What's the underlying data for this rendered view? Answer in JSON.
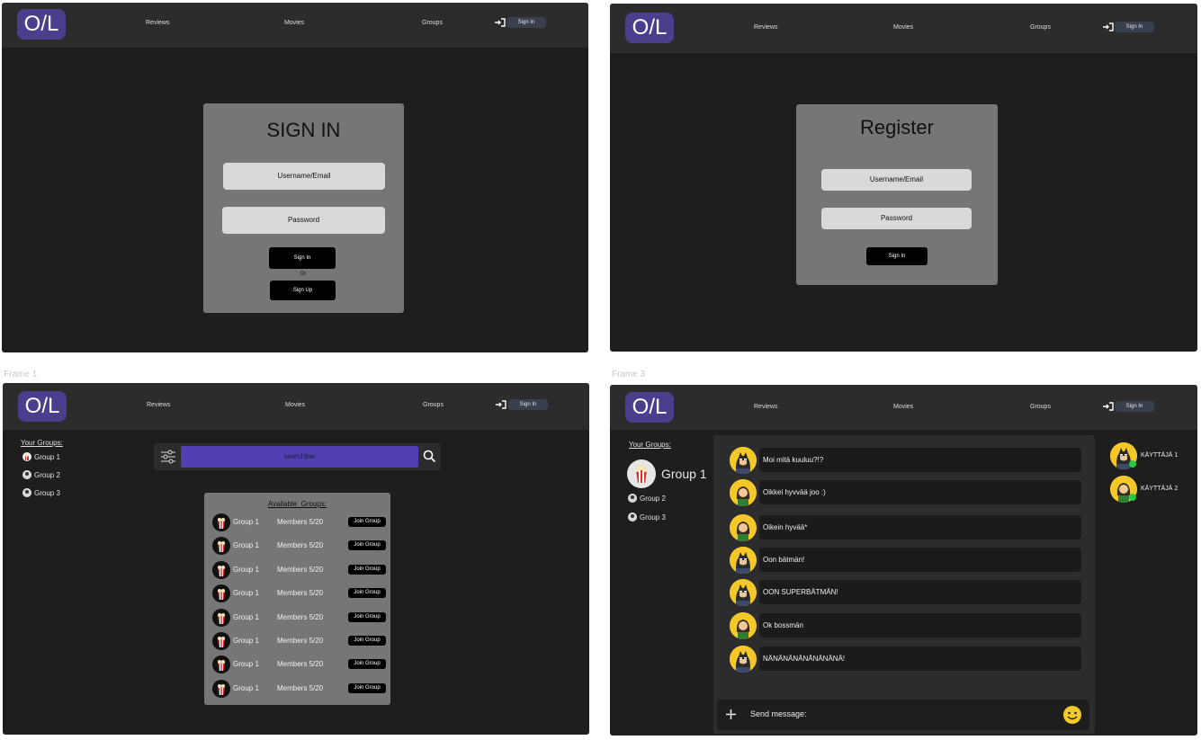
{
  "frames": {
    "frame1_label": "Frame 1",
    "frame3_label": "Frame 3"
  },
  "nav": {
    "logo": "O/L",
    "reviews": "Reviews",
    "movies": "Movies",
    "groups": "Groups",
    "sign_in": "Sign In"
  },
  "signin": {
    "title": "SIGN IN",
    "username_placeholder": "Username/Email",
    "password_placeholder": "Password",
    "signin_button": "Sign In",
    "or": "Or",
    "signup_button": "Sign Up"
  },
  "register": {
    "title": "Register",
    "username_placeholder": "Username/Email",
    "password_placeholder": "Password",
    "signin_button": "Sign In"
  },
  "groups_page": {
    "your_groups": "Your Groups:",
    "groups": [
      "Group 1",
      "Group 2",
      "Group 3"
    ],
    "searchbar": "searchbar",
    "available_title": "Available  Groups:",
    "rows": [
      {
        "name": "Group 1",
        "members": "Members 5/20",
        "join": "Join Group"
      },
      {
        "name": "Group 1",
        "members": "Members 5/20",
        "join": "Join Group"
      },
      {
        "name": "Group 1",
        "members": "Members 5/20",
        "join": "Join Group"
      },
      {
        "name": "Group 1",
        "members": "Members 5/20",
        "join": "Join Group"
      },
      {
        "name": "Group 1",
        "members": "Members 5/20",
        "join": "Join Group"
      },
      {
        "name": "Group 1",
        "members": "Members 5/20",
        "join": "Join Group"
      },
      {
        "name": "Group 1",
        "members": "Members 5/20",
        "join": "Join Group"
      },
      {
        "name": "Group 1",
        "members": "Members 5/20",
        "join": "Join Group"
      }
    ]
  },
  "chat_page": {
    "your_groups": "Your Groups:",
    "active_group": "Group 1",
    "groups": [
      "Group 2",
      "Group 3"
    ],
    "messages": [
      {
        "avatar": "batman",
        "text": "Moi mitä kuuluu?!?"
      },
      {
        "avatar": "girl",
        "text": "Oikkei hyvvää joo :)"
      },
      {
        "avatar": "girl",
        "text": "Oikein hyvää*"
      },
      {
        "avatar": "batman",
        "text": "Oon bätmän!"
      },
      {
        "avatar": "batman",
        "text": "OON SUPERBÄTMÄN!"
      },
      {
        "avatar": "girl",
        "text": "Ok bossmän"
      },
      {
        "avatar": "batman",
        "text": "NÄNÄNÄNÄNÄNÄNÄNÄ!"
      }
    ],
    "send_placeholder": "Send message:",
    "users": [
      {
        "avatar": "batman",
        "name": "KÄYTTÄJÄ 1",
        "status_color": "#27c93f"
      },
      {
        "avatar": "girl",
        "name": "KÄYTTÄJÄ 2",
        "status_color": "#27c93f"
      }
    ]
  },
  "colors": {
    "brand_purple": "#4a3f8c",
    "search_purple": "#5040b4",
    "avatar_yellow": "#f5c82a"
  }
}
